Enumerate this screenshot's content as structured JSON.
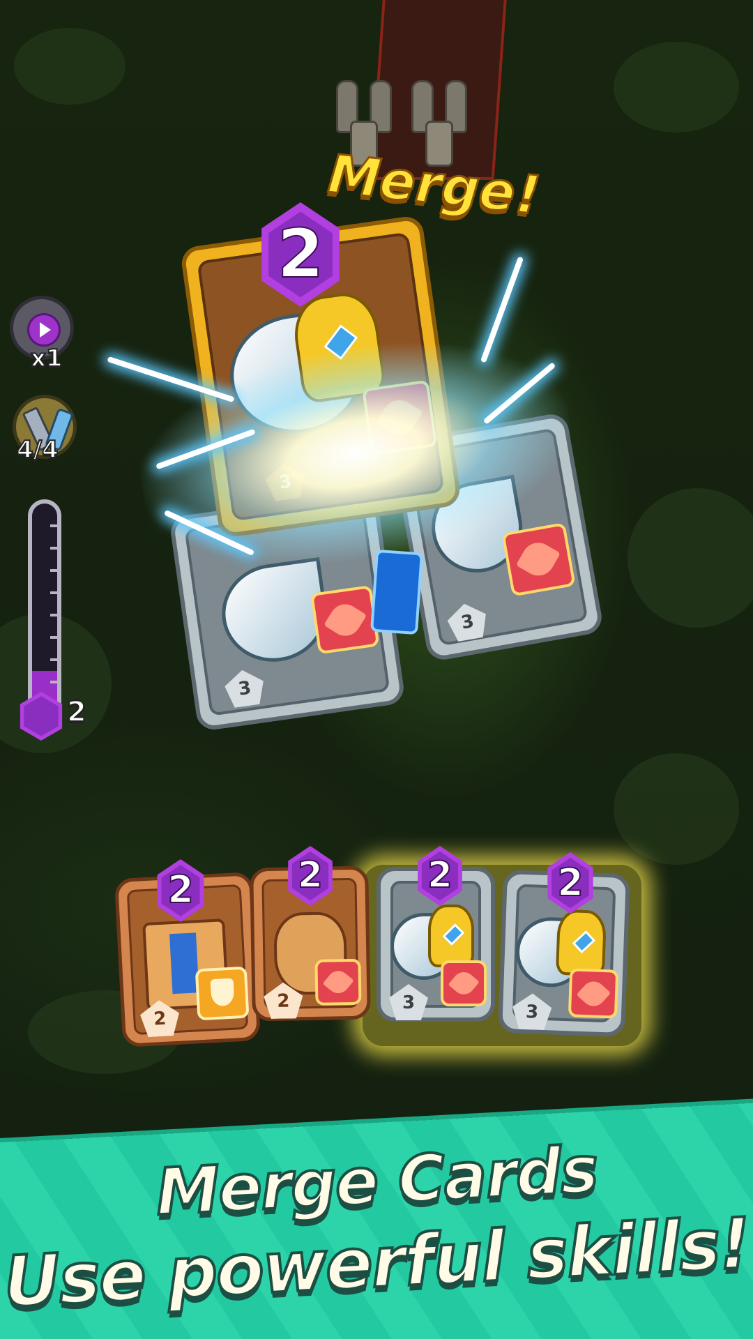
{
  "game": {
    "merge_label": "Merge!",
    "speed_label": "x1",
    "weapon_slots_label": "4/4",
    "level_meter": {
      "level_label": "2",
      "fill_fraction": 0.22
    }
  },
  "merge_result_card": {
    "level": "2",
    "cost": "3",
    "rarity": "gold",
    "weapon": "axe-icon",
    "skill": "slash-skill-icon"
  },
  "merging_cards": [
    {
      "cost": "3",
      "rarity": "silver",
      "weapon": "axe-icon",
      "skill": "slash-skill-icon"
    },
    {
      "cost": "3",
      "rarity": "silver",
      "weapon": "axe-icon",
      "skill": "slash-skill-icon"
    }
  ],
  "hand_cards": [
    {
      "level": "2",
      "cost": "2",
      "rarity": "bronze",
      "item": "scroll-icon",
      "skill": "shield-skill-icon"
    },
    {
      "level": "2",
      "cost": "2",
      "rarity": "bronze",
      "item": "potion-bottle-icon",
      "skill": "slash-skill-icon"
    },
    {
      "level": "2",
      "cost": "3",
      "rarity": "silver",
      "item": "axe-icon",
      "skill": "slash-skill-icon"
    },
    {
      "level": "2",
      "cost": "3",
      "rarity": "silver",
      "item": "axe-icon",
      "skill": "slash-skill-icon"
    }
  ],
  "banner": {
    "line1": "Merge Cards",
    "line2": "Use powerful skills!",
    "color": "#2dd4aa"
  },
  "colors": {
    "merge_text": "#ffe23a",
    "level_gem": "#b23fe0",
    "lightning": "#5cc8ff"
  }
}
